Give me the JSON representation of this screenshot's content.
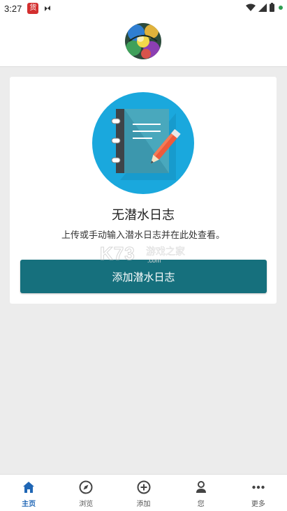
{
  "status_bar": {
    "time": "3:27",
    "app_badge": "货"
  },
  "main": {
    "empty_title": "无潜水日志",
    "empty_subtitle": "上传或手动输入潜水日志并在此处查看。",
    "add_button_label": "添加潜水日志"
  },
  "watermark": {
    "brand": "K73",
    "name": "游戏之家",
    "url": ".com"
  },
  "bottom_nav": {
    "items": [
      {
        "label": "主页",
        "icon": "home-icon",
        "active": true
      },
      {
        "label": "浏览",
        "icon": "compass-icon",
        "active": false
      },
      {
        "label": "添加",
        "icon": "plus-circle-icon",
        "active": false
      },
      {
        "label": "您",
        "icon": "person-icon",
        "active": false
      },
      {
        "label": "更多",
        "icon": "more-icon",
        "active": false
      }
    ]
  },
  "colors": {
    "primary": "#16707d",
    "active_nav": "#1f66b5",
    "illustration_bg": "#1aa8dd"
  }
}
